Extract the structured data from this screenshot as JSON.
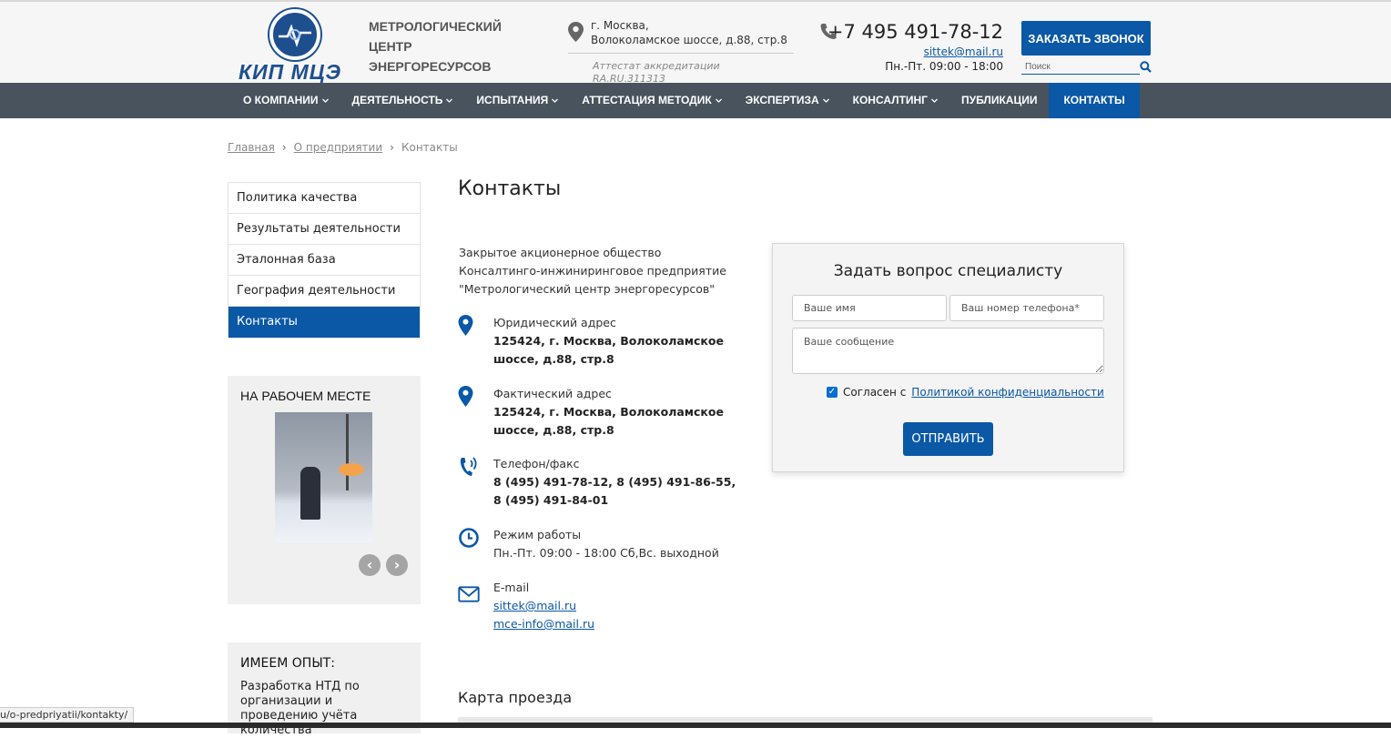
{
  "header": {
    "logo_text": "КИП МЦЭ",
    "org_name": [
      "МЕТРОЛОГИЧЕСКИЙ",
      "ЦЕНТР",
      "ЭНЕРГОРЕСУРСОВ"
    ],
    "address_line1": "г. Москва,",
    "address_line2": "Волоколамское шоссе, д.88, стр.8",
    "attest_line1": "Аттестат аккредитации",
    "attest_line2": "RA.RU.311313",
    "phone": "+7 495 491-78-12",
    "email": "sittek@mail.ru",
    "hours": "Пн.-Пт. 09:00 - 18:00",
    "callback_label": "ЗАКАЗАТЬ ЗВОНОК",
    "search_placeholder": "Поиск"
  },
  "nav": {
    "items": [
      {
        "label": "О КОМПАНИИ"
      },
      {
        "label": "ДЕЯТЕЛЬНОСТЬ"
      },
      {
        "label": "ИСПЫТАНИЯ"
      },
      {
        "label": "АТТЕСТАЦИЯ МЕТОДИК"
      },
      {
        "label": "ЭКСПЕРТИЗА"
      },
      {
        "label": "КОНСАЛТИНГ"
      },
      {
        "label": "ПУБЛИКАЦИИ"
      },
      {
        "label": "КОНТАКТЫ"
      }
    ]
  },
  "breadcrumb": {
    "home": "Главная",
    "parent": "О предприятии",
    "current": "Контакты",
    "sep": "›"
  },
  "sidebar": {
    "items": [
      {
        "label": "Политика качества"
      },
      {
        "label": "Результаты деятельности"
      },
      {
        "label": "Эталонная база"
      },
      {
        "label": "География деятельности"
      },
      {
        "label": "Контакты"
      }
    ],
    "work_title": "НА РАБОЧЕМ МЕСТЕ",
    "exp_title": "ИМЕЕМ ОПЫТ:",
    "exp_text": "Разработка НТД по организации и проведению учёта количества"
  },
  "main": {
    "title": "Контакты",
    "company": [
      "Закрытое акционерное общество",
      "Консалтинго-инжиниринговое предприятие",
      "\"Метрологический центр энергоресурсов\""
    ],
    "legal_label": "Юридический адрес",
    "legal_value": "125424, г. Москва, Волоколамское шоссе, д.88, стр.8",
    "actual_label": "Фактический адрес",
    "actual_value": "125424, г. Москва, Волоколамское шоссе, д.88, стр.8",
    "phone_label": "Телефон/факс",
    "phone_line1": "8 (495) 491-78-12, 8 (495) 491-86-55,",
    "phone_line2": "8 (495) 491-84-01",
    "hours_label": "Режим работы",
    "hours_value": "Пн.-Пт. 09:00 - 18:00 Сб,Вс. выходной",
    "email_label": "E-mail",
    "email1": "sittek@mail.ru",
    "email2": "mce-info@mail.ru",
    "map_title": "Карта проезда"
  },
  "form": {
    "title": "Задать вопрос специалисту",
    "name_placeholder": "Ваше имя",
    "phone_placeholder": "Ваш номер телефона*",
    "message_placeholder": "Ваше сообщение",
    "agree_text": "Согласен с",
    "agree_link": "Политикой конфиденциальности",
    "agreed": true,
    "submit_label": "ОТПРАВИТЬ"
  },
  "status_bar": {
    "url": "u/o-predpriyatii/kontakty/"
  },
  "colors": {
    "accent": "#0a58a6",
    "nav_bg": "#48535d"
  }
}
